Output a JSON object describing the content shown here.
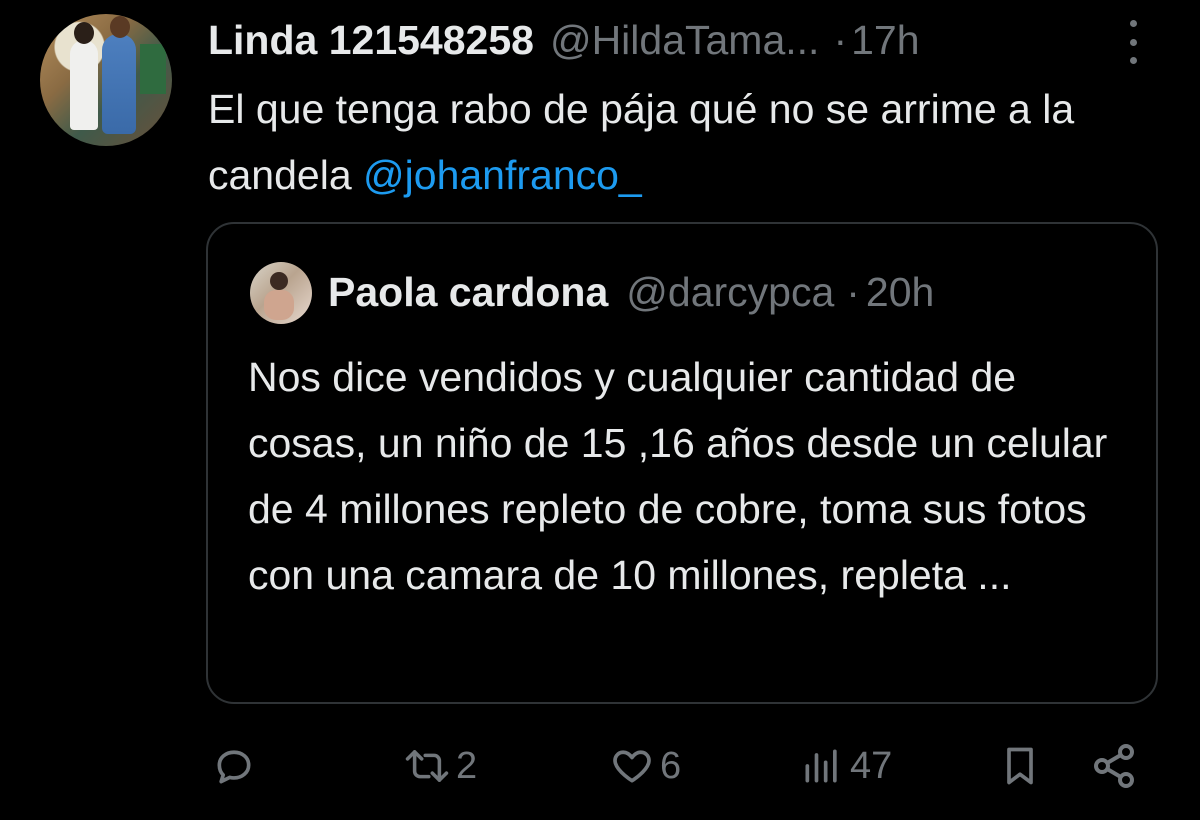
{
  "tweet": {
    "author_name": "Linda 121548258",
    "author_handle": "@HildaTama...",
    "separator": "·",
    "time": "17h",
    "text": "El que tenga rabo de pája qué no se arrime a la candela",
    "mention": "@johanfranco_"
  },
  "quote": {
    "author_name": "Paola cardona",
    "author_handle": "@darcypca",
    "separator": "·",
    "time": "20h",
    "text": "Nos dice vendidos y cualquier cantidad de cosas, un niño de 15 ,16 años desde un celular de 4 millones repleto de cobre, toma sus fotos con una camara de 10 millones, repleta ..."
  },
  "actions": {
    "reply": {
      "icon": "reply-icon",
      "count": ""
    },
    "retweet": {
      "icon": "retweet-icon",
      "count": "2"
    },
    "like": {
      "icon": "heart-icon",
      "count": "6"
    },
    "views": {
      "icon": "views-icon",
      "count": "47"
    },
    "bookmark": {
      "icon": "bookmark-icon"
    },
    "share": {
      "icon": "share-icon"
    }
  },
  "colors": {
    "background": "#000000",
    "text": "#e7e9ea",
    "secondary": "#71767b",
    "link": "#1d9bf0",
    "border": "#2f3336"
  }
}
